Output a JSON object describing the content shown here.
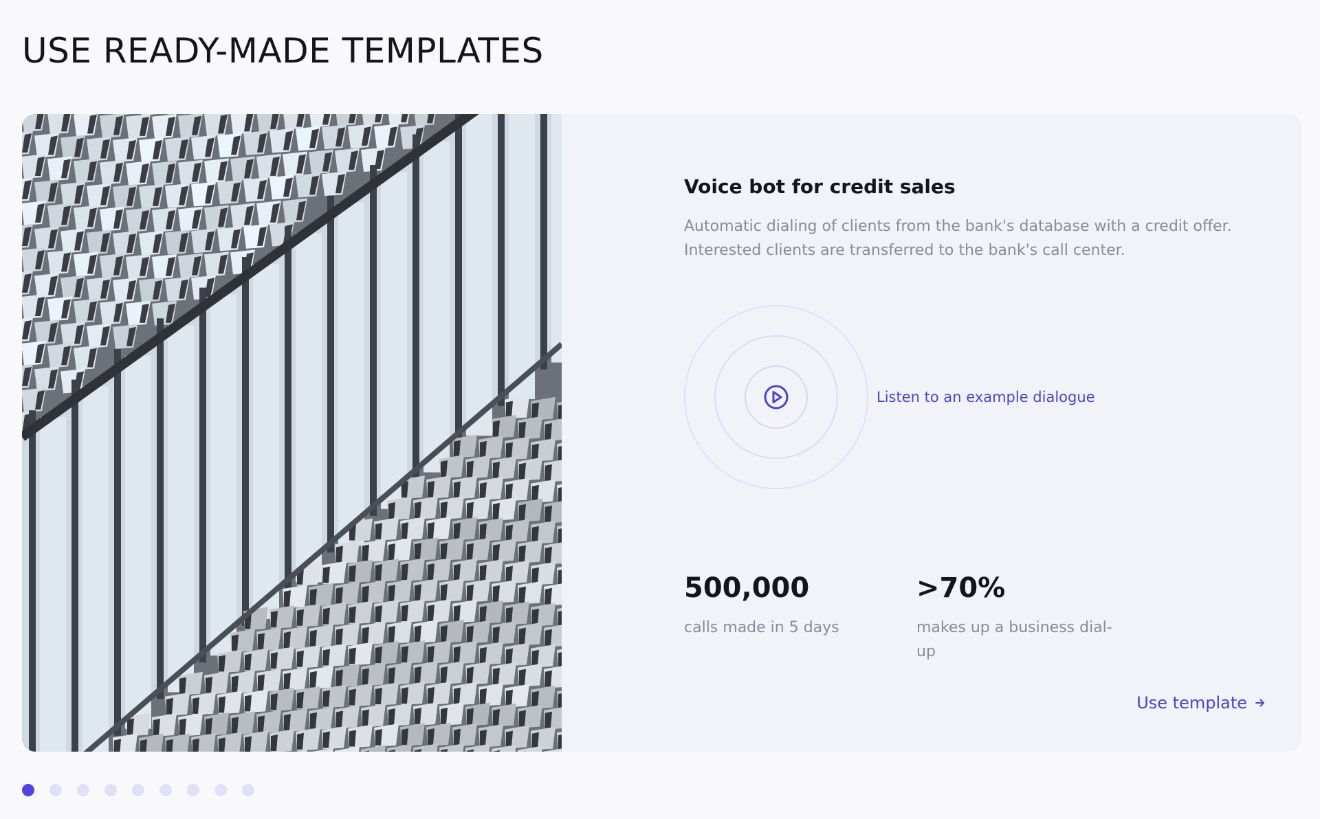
{
  "section": {
    "title": "USE READY-MADE TEMPLATES"
  },
  "template": {
    "title": "Voice bot for credit sales",
    "description": "Automatic dialing of clients from the bank's database with a credit offer. Interested clients are transferred to the bank's call center.",
    "listen_label": "Listen to an example dialogue",
    "play_icon": "play-circle-icon",
    "stats": [
      {
        "value": "500,000",
        "label": "calls made in 5 days"
      },
      {
        "value": ">70%",
        "label": "makes up a business dial-up"
      }
    ],
    "cta_label": "Use template",
    "cta_icon": "arrow-right-icon"
  },
  "carousel": {
    "dot_count": 9,
    "active_index": 0
  },
  "colors": {
    "accent": "#4b44c8",
    "active_dot": "#5046dd",
    "inactive_dot": "#e1e0f8",
    "card_bg": "#f2f3f8",
    "page_bg": "#f9f9fb"
  }
}
